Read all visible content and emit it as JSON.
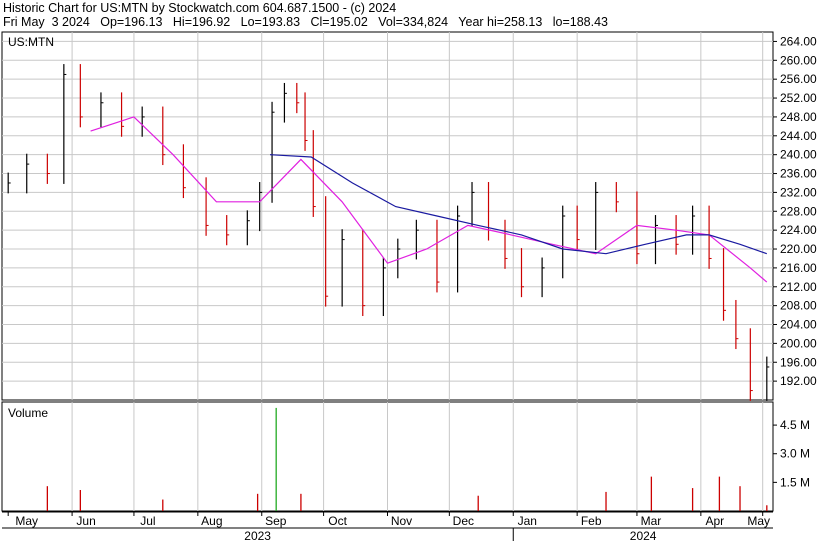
{
  "header": {
    "line1": "Historic Chart for US:MTN by Stockwatch.com 604.687.1500 - (c) 2024",
    "line2": "Fri May  3 2024   Op=196.13   Hi=196.92   Lo=193.83   Cl=195.02   Vol=334,824   Year hi=258.13   lo=188.43"
  },
  "colors": {
    "up_bar": "#000000",
    "down_bar": "#cc0000",
    "ma_short": "#e020e0",
    "ma_long": "#1a1aa0",
    "vol_up": "#22aa22",
    "vol_down": "#cc0000",
    "grid": "#c8c8c8"
  },
  "chart_data": [
    {
      "type": "line",
      "title": "US:MTN",
      "ylim": [
        188,
        266
      ],
      "y_ticks": [
        "264.00",
        "260.00",
        "256.00",
        "252.00",
        "248.00",
        "244.00",
        "240.00",
        "236.00",
        "232.00",
        "228.00",
        "224.00",
        "220.00",
        "216.00",
        "212.00",
        "208.00",
        "204.00",
        "200.00",
        "196.00",
        "192.00"
      ],
      "x_tick_labels": [
        "May",
        "Jun",
        "Jul",
        "Aug",
        "Sep",
        "Oct",
        "Nov",
        "Dec",
        "Jan",
        "Feb",
        "Mar",
        "Apr",
        "May"
      ],
      "year_labels": [
        "2023",
        "2024"
      ],
      "series": [
        {
          "kind": "price-hlc-bars",
          "x": [
            "2023-05-01",
            "2023-05-10",
            "2023-05-20",
            "2023-05-28",
            "2023-06-05",
            "2023-06-15",
            "2023-06-25",
            "2023-07-05",
            "2023-07-15",
            "2023-07-25",
            "2023-08-05",
            "2023-08-15",
            "2023-08-25",
            "2023-08-31",
            "2023-09-06",
            "2023-09-12",
            "2023-09-18",
            "2023-09-22",
            "2023-09-26",
            "2023-10-02",
            "2023-10-10",
            "2023-10-20",
            "2023-10-30",
            "2023-11-06",
            "2023-11-15",
            "2023-11-25",
            "2023-12-05",
            "2023-12-12",
            "2023-12-20",
            "2023-12-28",
            "2024-01-05",
            "2024-01-15",
            "2024-01-25",
            "2024-02-01",
            "2024-02-10",
            "2024-02-20",
            "2024-03-01",
            "2024-03-10",
            "2024-03-20",
            "2024-03-28",
            "2024-04-05",
            "2024-04-12",
            "2024-04-18",
            "2024-04-25",
            "2024-05-03"
          ],
          "close": [
            234,
            238,
            236,
            257,
            248,
            251,
            246,
            248,
            240,
            233,
            225,
            223,
            226,
            232,
            249,
            253,
            251,
            243,
            229,
            210,
            222,
            208,
            216,
            220,
            224,
            213,
            227,
            232,
            224,
            218,
            212,
            216,
            227,
            222,
            232,
            230,
            219,
            225,
            221,
            227,
            218,
            207,
            201,
            190,
            195
          ]
        },
        {
          "name": "",
          "kind": "moving-average-short",
          "x": [
            "2023-06-10",
            "2023-07-01",
            "2023-07-20",
            "2023-08-10",
            "2023-08-31",
            "2023-09-20",
            "2023-10-10",
            "2023-11-01",
            "2023-11-20",
            "2023-12-10",
            "2023-12-31",
            "2024-01-20",
            "2024-02-10",
            "2024-03-01",
            "2024-03-20",
            "2024-04-05",
            "2024-04-25",
            "2024-05-03"
          ],
          "y": [
            245,
            248,
            240,
            230,
            230,
            239,
            230,
            217,
            220,
            225,
            223,
            221,
            219,
            225,
            224,
            223,
            216,
            213
          ]
        },
        {
          "name": "",
          "kind": "moving-average-long",
          "x": [
            "2023-09-05",
            "2023-09-25",
            "2023-10-15",
            "2023-11-05",
            "2023-11-25",
            "2023-12-15",
            "2024-01-05",
            "2024-01-25",
            "2024-02-15",
            "2024-03-05",
            "2024-03-25",
            "2024-04-05",
            "2024-04-20",
            "2024-05-03"
          ],
          "y": [
            240,
            239.5,
            234,
            229,
            227,
            225,
            223,
            220,
            219,
            221,
            223,
            223,
            221,
            219
          ]
        }
      ]
    },
    {
      "type": "bar",
      "title": "Volume",
      "y_ticks": [
        "4.5 M",
        "3.0 M",
        "1.5 M"
      ],
      "ylim": [
        0,
        5.5
      ],
      "x": [
        "2023-05-20",
        "2023-06-05",
        "2023-07-15",
        "2023-08-30",
        "2023-09-08",
        "2023-09-20",
        "2023-12-15",
        "2024-02-15",
        "2024-03-08",
        "2024-03-28",
        "2024-04-10",
        "2024-04-20",
        "2024-05-03"
      ],
      "values": [
        1.3,
        1.1,
        0.6,
        0.9,
        5.4,
        0.9,
        0.8,
        1.0,
        1.8,
        1.2,
        1.8,
        1.3,
        0.3
      ]
    }
  ]
}
